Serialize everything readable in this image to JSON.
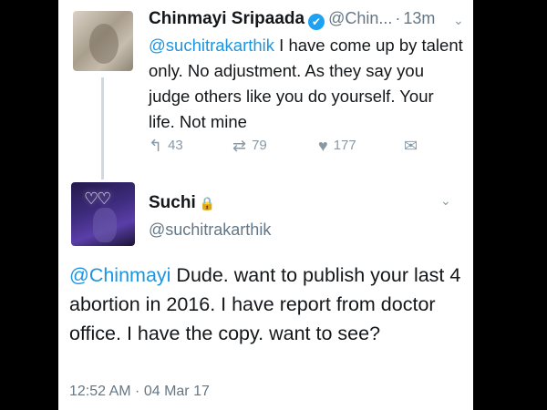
{
  "tweet1": {
    "name": "Chinmayi Sripaada",
    "verified_glyph": "✔",
    "handle": "@Chin...",
    "time": "13m",
    "mention": "@suchitrakarthik",
    "text": " I have come up by talent only. No adjustment. As they say you judge others like you do yourself. Your life. Not mine",
    "replies": "43",
    "retweets": "79",
    "likes": "177",
    "icons": {
      "reply": "reply-icon",
      "retweet": "retweet-icon",
      "like": "heart-icon",
      "dm": "envelope-icon"
    }
  },
  "tweet2": {
    "name": "Suchi",
    "lock_glyph": "🔒",
    "handle": "@suchitrakarthik",
    "mention": "@Chinmayi",
    "text": " Dude. want to publish your last 4 abortion in 2016. I have report  from doctor office. I have the copy. want to see?",
    "timestamp": "12:52 AM · 04 Mar 17"
  }
}
